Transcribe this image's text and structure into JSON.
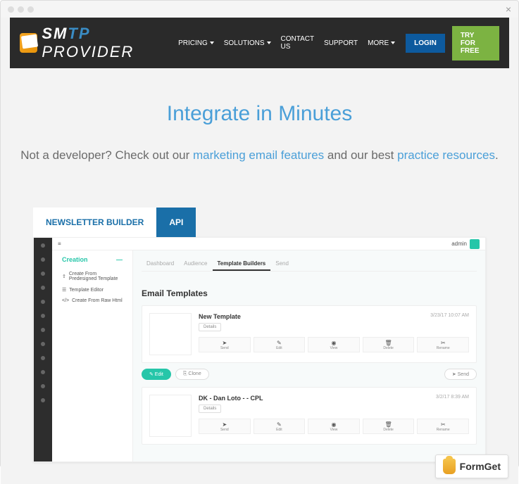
{
  "nav": {
    "brand_sm": "SM",
    "brand_tp": "TP",
    "brand_provider": " PROVIDER",
    "links": [
      "PRICING",
      "SOLUTIONS",
      "CONTACT US",
      "SUPPORT",
      "MORE"
    ],
    "login": "LOGIN",
    "try": "TRY FOR FREE"
  },
  "hero": {
    "title_a": "Integrate in ",
    "title_b": "Minutes",
    "sub_a": "Not a developer? Check out our ",
    "sub_link1": "marketing email features",
    "sub_b": " and our best ",
    "sub_link2": "practice resources",
    "sub_c": "."
  },
  "tabs": {
    "newsletter": "NEWSLETTER BUILDER",
    "api": "API"
  },
  "app": {
    "hamburger": "≡",
    "admin_label": "admin",
    "inner_tabs": [
      "Dashboard",
      "Audience",
      "Template Builders",
      "Send"
    ],
    "side_title": "Creation",
    "side_collapse": "—",
    "side_items": [
      {
        "icon": "⇪",
        "label": "Create From Predesigned Template"
      },
      {
        "icon": "☰",
        "label": "Template Editor"
      },
      {
        "icon": "</>",
        "label": "Create From Raw Html"
      }
    ],
    "content_title": "Email Templates",
    "cards": [
      {
        "title": "New Template",
        "date": "3/23/17 10:07 AM",
        "tag": "Details"
      },
      {
        "title": "DK - Dan Loto - - CPL",
        "date": "3/2/17 8:39 AM",
        "tag": "Details"
      }
    ],
    "card_actions": [
      {
        "icon": "➤",
        "label": "Send"
      },
      {
        "icon": "✎",
        "label": "Edit"
      },
      {
        "icon": "◉",
        "label": "View"
      },
      {
        "icon": "🗑",
        "label": "Delete"
      },
      {
        "icon": "✂",
        "label": "Rename"
      }
    ],
    "footer_pills": {
      "edit": "✎ Edit",
      "clone": "⎘ Clone",
      "send": "➤ Send"
    }
  },
  "badge": "FormGet"
}
